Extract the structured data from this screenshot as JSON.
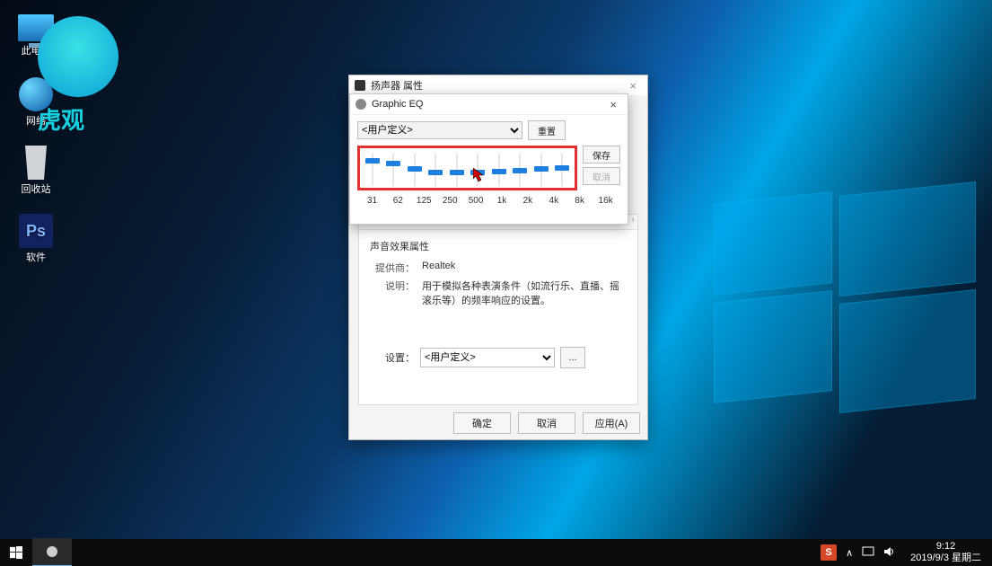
{
  "desktop": {
    "icons": {
      "this_pc": "此电脑",
      "network": "网络",
      "recycle_bin": "回收站",
      "software": "软件"
    },
    "watermark": "虎观"
  },
  "prop_dialog": {
    "title": "扬声器 属性",
    "group_title": "声音效果属性",
    "provider_label": "提供商：",
    "provider_value": "Realtek",
    "description_label": "说明：",
    "description_value": "用于模拟各种表演条件（如流行乐、直播、摇滚乐等）的频率响应的设置。",
    "setting_label": "设置：",
    "setting_value": "<用户定义>",
    "more_button": "...",
    "scroll_left": "‹",
    "scroll_right": "›",
    "ok": "确定",
    "cancel": "取消",
    "apply": "应用(A)"
  },
  "eq_dialog": {
    "title": "Graphic EQ",
    "preset": "<用户定义>",
    "reset": "重置",
    "save": "保存",
    "cancel": "取消",
    "bands": [
      "31",
      "62",
      "125",
      "250",
      "500",
      "1k",
      "2k",
      "4k",
      "8k",
      "16k"
    ],
    "thumb_positions": [
      5,
      8,
      14,
      18,
      18,
      18,
      17,
      16,
      14,
      13
    ]
  },
  "taskbar": {
    "ime_badge": "S",
    "tray_caret": "∧",
    "time": "9:12",
    "date": "2019/9/3 星期二"
  }
}
